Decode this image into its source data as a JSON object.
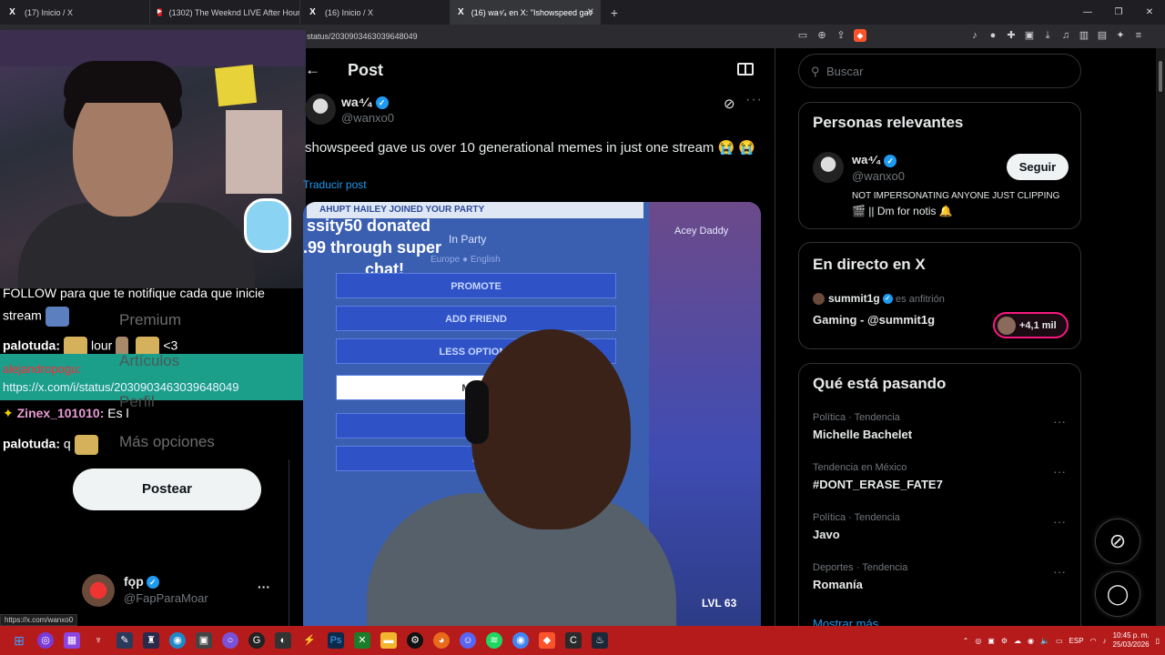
{
  "browser": {
    "tabs": [
      {
        "label": "(17) Inicio / X",
        "icon": "x-logo-icon",
        "active": false
      },
      {
        "label": "(1302) The Weeknd LIVE After Hours",
        "icon": "youtube-icon",
        "active": false
      },
      {
        "label": "(16) Inicio / X",
        "icon": "x-logo-icon",
        "active": false
      },
      {
        "label": "(16) wa⁴⁄₄ en X: \"Ishowspeed gav",
        "icon": "x-logo-icon",
        "active": true
      }
    ],
    "url": "status/2030903463039648049",
    "new_tab": "+",
    "status_url": "https://x.com/wanxo0",
    "accent": "#fb542b"
  },
  "stream_overlay": {
    "chat": [
      {
        "text": "FOLLOW para que te notifique cada que inicie"
      },
      {
        "text": "stream"
      },
      {
        "user": "palotuda:",
        "text": "lour",
        "after": "<3"
      },
      {
        "user": "alejandropogu:",
        "text": "https://x.com/i/status/2030903463039648049"
      },
      {
        "user": "Zinex_101010:",
        "text": "Es l"
      },
      {
        "user": "palotuda:",
        "text": "q"
      }
    ]
  },
  "sidebar": {
    "ghost_items": [
      "Premium",
      "Artículos",
      "Perfil",
      "Más opciones"
    ],
    "post_button": "Postear",
    "account": {
      "name": "fǫp",
      "handle": "@FapParaMoar",
      "more": "···"
    }
  },
  "post": {
    "header_title": "Post",
    "author_name": "wa⁴⁄₄",
    "author_handle": "@wanxo0",
    "text": "showspeed gave us over 10 generational memes in just one stream 😭 😭",
    "translate": "Traducir post",
    "media": {
      "top_bar": "AHUPT HAILEY JOINED YOUR PARTY",
      "donation_line1": "ssity50 donated",
      "donation_line2": ".99 through super",
      "donation_line3": "chat!",
      "in_party": "In Party",
      "region": "Europe ● English",
      "buttons": [
        "PROMOTE",
        "ADD FRIEND",
        "LESS OPTIONS",
        "MUTE",
        "",
        "B"
      ],
      "other_player": "Acey Daddy",
      "level": "LVL 63"
    }
  },
  "search": {
    "placeholder": "Buscar"
  },
  "relevant": {
    "title": "Personas relevantes",
    "name": "wa⁴⁄₄",
    "handle": "@wanxo0",
    "follow": "Seguir",
    "bio1": "NOT IMPERSONATING ANYONE JUST CLIPPING",
    "bio2": "🎬 || Dm for notis 🔔"
  },
  "live": {
    "title": "En directo en X",
    "host": "summit1g",
    "host_suffix": "es anfitrión",
    "stream_title": "Gaming - @summit1g",
    "listeners": "+4,1 mil"
  },
  "trends": {
    "title": "Qué está pasando",
    "items": [
      {
        "category": "Política · Tendencia",
        "name": "Michelle Bachelet"
      },
      {
        "category": "Tendencia en México",
        "name": "#DONT_ERASE_FATE7"
      },
      {
        "category": "Política · Tendencia",
        "name": "Javo"
      },
      {
        "category": "Deportes · Tendencia",
        "name": "Romanía"
      }
    ],
    "show_more": "Mostrar más"
  },
  "taskbar": {
    "lang": "ESP",
    "time": "10:45 p. m.",
    "date": "25/03/2026",
    "color": "#b51b1b"
  }
}
